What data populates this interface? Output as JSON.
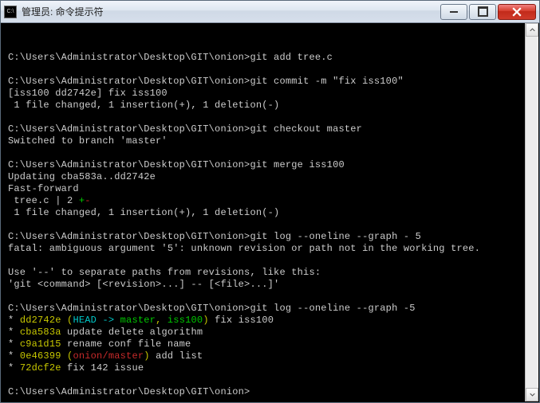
{
  "window": {
    "icon_label": "C:\\",
    "title": "管理员: 命令提示符"
  },
  "terminal": {
    "prompt": "C:\\Users\\Administrator\\Desktop\\GIT\\onion>",
    "lines": [
      {
        "t": "cmd",
        "c": "git add tree.c"
      },
      {
        "t": "blank"
      },
      {
        "t": "cmd",
        "c": "git commit -m \"fix iss100\""
      },
      {
        "t": "out",
        "c": "[iss100 dd2742e] fix iss100"
      },
      {
        "t": "out",
        "c": " 1 file changed, 1 insertion(+), 1 deletion(-)"
      },
      {
        "t": "blank"
      },
      {
        "t": "cmd",
        "c": "git checkout master"
      },
      {
        "t": "out",
        "c": "Switched to branch 'master'"
      },
      {
        "t": "blank"
      },
      {
        "t": "cmd",
        "c": "git merge iss100"
      },
      {
        "t": "out",
        "c": "Updating cba583a..dd2742e"
      },
      {
        "t": "out",
        "c": "Fast-forward"
      },
      {
        "t": "diffstat",
        "file": " tree.c | 2 ",
        "plus": "+",
        "minus": "-"
      },
      {
        "t": "out",
        "c": " 1 file changed, 1 insertion(+), 1 deletion(-)"
      },
      {
        "t": "blank"
      },
      {
        "t": "cmd",
        "c": "git log --oneline --graph - 5"
      },
      {
        "t": "out",
        "c": "fatal: ambiguous argument '5': unknown revision or path not in the working tree."
      },
      {
        "t": "blank"
      },
      {
        "t": "out",
        "c": "Use '--' to separate paths from revisions, like this:"
      },
      {
        "t": "out",
        "c": "'git <command> [<revision>...] -- [<file>...]'"
      },
      {
        "t": "blank"
      },
      {
        "t": "cmd",
        "c": "git log --oneline --graph -5"
      },
      {
        "t": "log",
        "star": "* ",
        "hash": "dd2742e",
        "after_hash": " (",
        "ref1": "HEAD -> ",
        "ref2": "master",
        "ref2b": ", ",
        "ref3": "iss100",
        "close": ")",
        "msg": " fix iss100"
      },
      {
        "t": "log",
        "star": "* ",
        "hash": "cba583a",
        "msg": " update delete algorithm"
      },
      {
        "t": "log",
        "star": "* ",
        "hash": "c9a1d15",
        "msg": " rename conf file name"
      },
      {
        "t": "log",
        "star": "* ",
        "hash": "0e46399",
        "after_hash": " (",
        "remote": "onion/master",
        "close": ")",
        "msg": " add list"
      },
      {
        "t": "log",
        "star": "* ",
        "hash": "72dcf2e",
        "msg": " fix 142 issue"
      },
      {
        "t": "blank"
      },
      {
        "t": "cmd",
        "c": ""
      }
    ]
  }
}
